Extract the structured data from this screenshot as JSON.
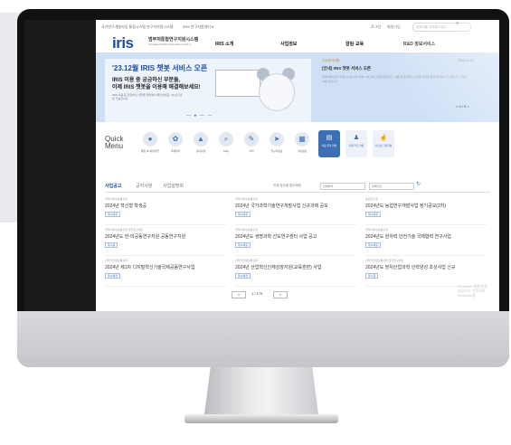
{
  "topbar": {
    "links": [
      "국가연구개발사업 통합시스템",
      "연구자지원시스템",
      "IRIS 연구지원센터 ▾"
    ],
    "right_links": [
      "로그인",
      "회원가입"
    ],
    "search_placeholder": "검색어를 입력해주세요"
  },
  "header": {
    "logo": "iris",
    "logo_sub": "범부처통합연구지원시스템",
    "logo_sub_en": "Integrated R&D Information System",
    "nav": [
      "IRIS 소개",
      "사업정보",
      "알림·교육",
      "R&D 정보서비스"
    ]
  },
  "hero": {
    "title": "'23.12월 IRIS 챗봇 서비스 오픈",
    "line1": "IRIS 이용 중 궁금하신 부분들,",
    "line2": "이제 IRIS 챗봇을 이용해 해결해보세요!",
    "desc": "IRIS 이용 중 궁금하신 사항을 챗봇에서 확인하세요. 24시간 답변 가능합니다.",
    "dots": "— ● — —"
  },
  "notice": {
    "tag": "주요공지사항",
    "date": "2023-12-13",
    "title": "[안내] IRIS 챗봇 서비스 오픈",
    "body": "범부처통합연구지원시스템 IRIS 챗봇 서비스를 오픈하였습니다. 이용 중 궁금하신 사항을 챗봇을 통해 문의하시기 바랍니다. 많은 이용 바랍니다.",
    "pager": "< 4 / 5 >"
  },
  "quick": {
    "label_top": "Quick",
    "label_bottom": "Menu",
    "items": [
      "통합 ID 회원가입",
      "과제관리",
      "공지사항",
      "FAQ",
      "서식",
      "연구자정보",
      "기관정보"
    ],
    "buttons": [
      "제출 접수현황",
      "회원가입 현황",
      "자료실 신청현황"
    ]
  },
  "board": {
    "tabs": [
      "사업공고",
      "공지사항",
      "사업설명회"
    ],
    "right": "전체 접수중 접수예정",
    "select1": "전체부처",
    "select2": "전체기관"
  },
  "cards": [
    {
      "meta": "과학기술정보통신부",
      "title": "2024년 혁신형 학생공",
      "badge": "접수예정"
    },
    {
      "meta": "과학기술정보통신부",
      "title": "2024년 국가과학기술연구개발사업 신규과제 공모",
      "badge": "접수예정"
    },
    {
      "meta": "농촌진흥청",
      "title": "2024년도 농업연구개발사업 정기공모(2차)",
      "badge": "접수예정"
    },
    {
      "meta": "과학기술정보통신부 한국연구재단",
      "title": "2024년도 한-미공동연구지원 공동연구지원",
      "badge": "접수중"
    },
    {
      "meta": "과학기술정보통신부",
      "title": "2024년도 생명과학 선도연구센터 사업 공고",
      "badge": "접수예정"
    },
    {
      "meta": "과학기술정보통신부",
      "title": "2024년도 원자력 안전기술 국제협력 연구사업",
      "badge": "접수예정"
    },
    {
      "meta": "과학기술정보통신부",
      "title": "2024년 제1차 디지털혁신기술국제공동연구사업",
      "badge": "접수예정"
    },
    {
      "meta": "과학기술정보통신부",
      "title": "2024년 산업혁신인재성장지원(교육훈련) 사업",
      "badge": "접수예정"
    },
    {
      "meta": "과학기술정보통신부 한국연구재단",
      "title": "2024년도 방위산업과학 인력양성 초성사업 신규",
      "badge": "접수중"
    }
  ],
  "pagination": {
    "prev": "<",
    "current": "1 / 175",
    "next": ">"
  },
  "watermark": [
    "Windows 정품 인증",
    "설정으로 이동하여 Windows를"
  ]
}
